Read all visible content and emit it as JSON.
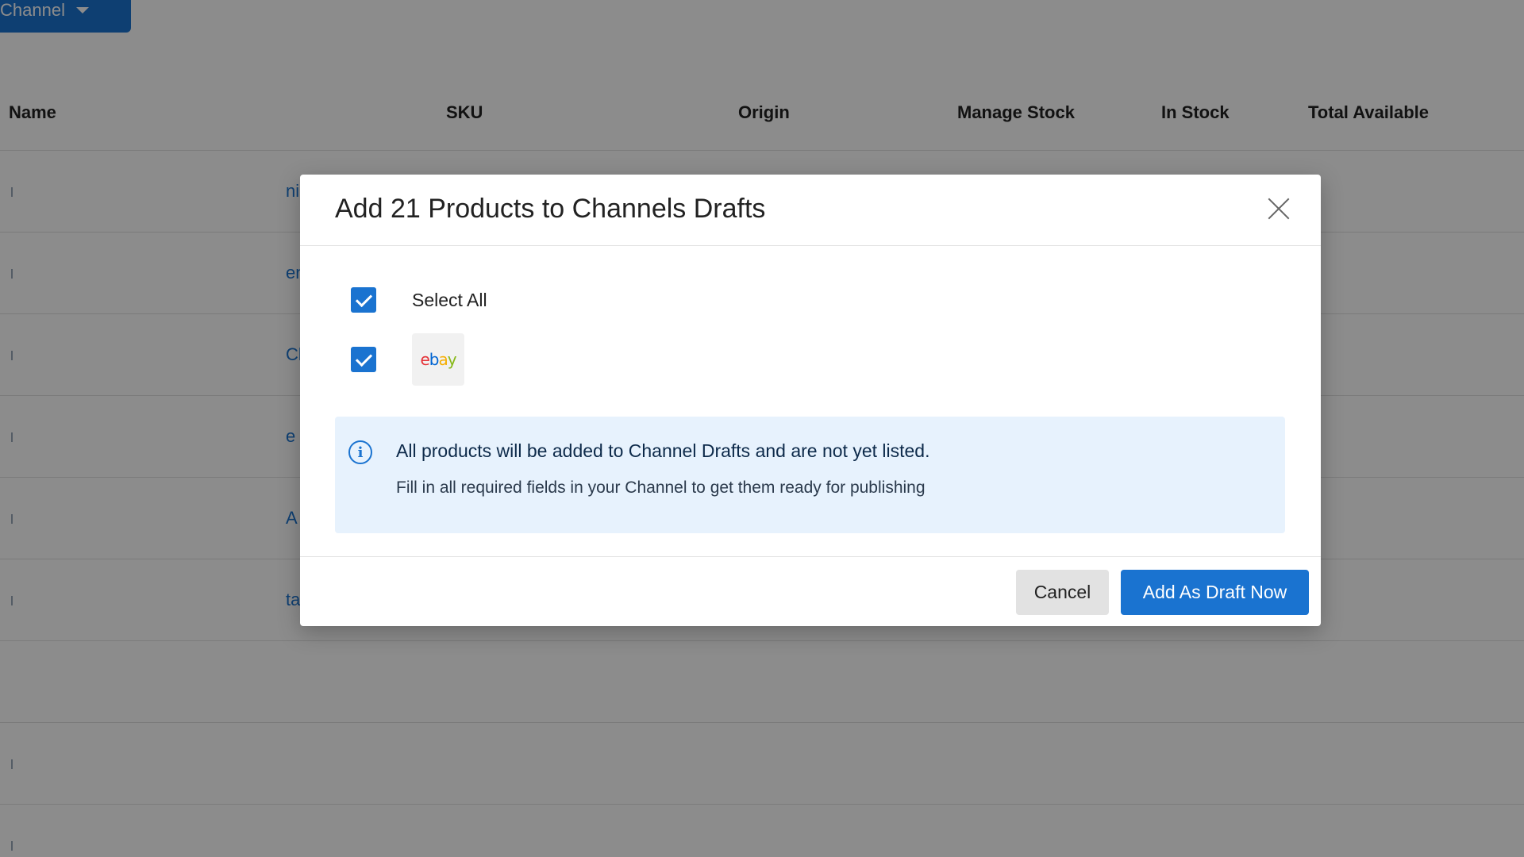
{
  "background": {
    "channel_button": "Channel",
    "table": {
      "headers": [
        "Name",
        "SKU",
        "Origin",
        "Manage Stock",
        "In Stock",
        "Total Available"
      ],
      "row_links": [
        "ni",
        "en",
        "Cl",
        "e",
        "A",
        "ta"
      ]
    }
  },
  "modal": {
    "title": "Add 21 Products to Channels Drafts",
    "select_all_label": "Select All",
    "channels": [
      {
        "name": "ebay",
        "checked": true
      }
    ],
    "info": {
      "title": "All products will be added to Channel Drafts and are not yet listed.",
      "text": "Fill in all required fields in your Channel to get them ready for publishing"
    },
    "buttons": {
      "cancel": "Cancel",
      "add_draft": "Add As Draft Now"
    }
  },
  "colors": {
    "accent": "#1a73d0",
    "info_bg": "#e7f2fd"
  }
}
